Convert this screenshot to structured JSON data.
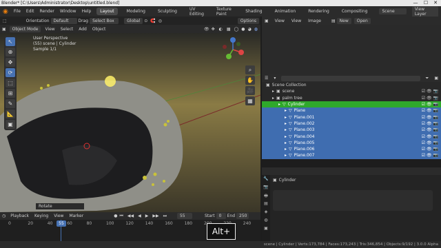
{
  "window": {
    "title": "Blender* [C:\\Users\\Administrator\\Desktop\\untitled.blend]",
    "minimize": "—",
    "maximize": "☐",
    "close": "✕"
  },
  "menu": [
    "File",
    "Edit",
    "Render",
    "Window",
    "Help"
  ],
  "workspaces": [
    "Layout",
    "Modeling",
    "Sculpting",
    "UV Editing",
    "Texture Paint",
    "Shading",
    "Animation",
    "Rendering",
    "Compositing"
  ],
  "scene": {
    "label": "Scene",
    "view_layer": "View Layer"
  },
  "viewport": {
    "orientation_label": "Orientation",
    "orientation_value": "Default",
    "drag_label": "Drag",
    "drag_value": "Select Box",
    "transform": "Global",
    "options": "Options",
    "mode": "Object Mode",
    "menu": [
      "View",
      "Select",
      "Add",
      "Object"
    ],
    "overlay_text": [
      "User Perspective",
      "(55) scene | Cylinder",
      "Sample 1/1"
    ],
    "last_op": "Rotate",
    "gizmo": {
      "x": "X",
      "y": "Y",
      "z": "Z"
    }
  },
  "image_editor": {
    "menu": [
      "View",
      "View",
      "Image"
    ],
    "new": "New",
    "open": "Open"
  },
  "outliner": {
    "root": "Scene Collection",
    "rows": [
      {
        "name": "scene",
        "indent": 1,
        "state": "normal"
      },
      {
        "name": "palm tree",
        "indent": 1,
        "state": "normal"
      },
      {
        "name": "Cylinder",
        "indent": 2,
        "state": "active"
      },
      {
        "name": "Plane",
        "indent": 3,
        "state": "sel"
      },
      {
        "name": "Plane.001",
        "indent": 3,
        "state": "sel"
      },
      {
        "name": "Plane.002",
        "indent": 3,
        "state": "sel"
      },
      {
        "name": "Plane.003",
        "indent": 3,
        "state": "sel"
      },
      {
        "name": "Plane.004",
        "indent": 3,
        "state": "sel"
      },
      {
        "name": "Plane.005",
        "indent": 3,
        "state": "sel"
      },
      {
        "name": "Plane.006",
        "indent": 3,
        "state": "sel"
      },
      {
        "name": "Plane.007",
        "indent": 3,
        "state": "sel"
      }
    ]
  },
  "properties": {
    "object": "Cylinder"
  },
  "timeline": {
    "menu": [
      "Playback",
      "Keying",
      "View",
      "Marker"
    ],
    "current_frame": "55",
    "start_label": "Start",
    "start": "0",
    "end_label": "End",
    "end": "250",
    "ticks": [
      "0",
      "20",
      "40",
      "60",
      "80",
      "100",
      "120",
      "140",
      "160",
      "180",
      "200",
      "220",
      "240"
    ]
  },
  "status": "scene | Cylinder | Verts:173,784 | Faces:173,243 | Tris:346,854 | Objects:9/192 | 3.0.0 Alpha",
  "keystroke": "Alt+"
}
